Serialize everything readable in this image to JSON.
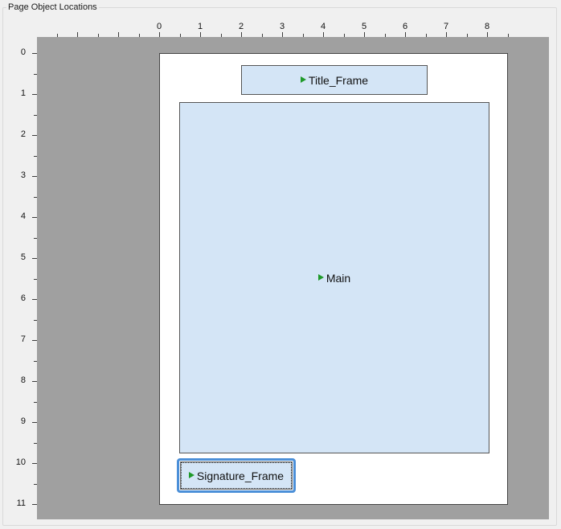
{
  "group_title": "Page Object Locations",
  "ruler": {
    "h_labels": [
      "0",
      "1",
      "2",
      "3",
      "4",
      "5",
      "6",
      "7",
      "8"
    ],
    "v_labels": [
      "0",
      "1",
      "2",
      "3",
      "4",
      "5",
      "6",
      "7",
      "8",
      "9",
      "10",
      "11"
    ]
  },
  "frames": {
    "title": {
      "label": "Title_Frame"
    },
    "main": {
      "label": "Main"
    },
    "signature": {
      "label": "Signature_Frame"
    }
  },
  "colors": {
    "canvas": "#a0a0a0",
    "page": "#ffffff",
    "frame_fill": "#d4e5f6",
    "frame_arrow": "#1f9a2a",
    "selection": "#4b8fd8"
  }
}
